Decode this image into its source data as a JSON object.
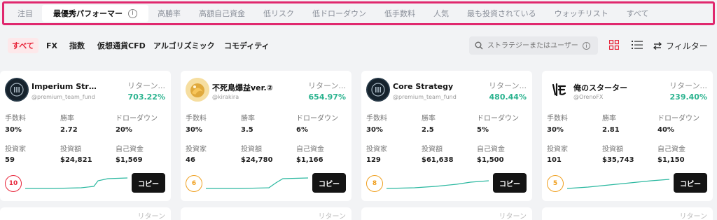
{
  "top_tabs": [
    {
      "label": "注目"
    },
    {
      "label": "最優秀パフォーマー",
      "info": "i"
    },
    {
      "label": "高勝率"
    },
    {
      "label": "高額自己資金"
    },
    {
      "label": "低リスク"
    },
    {
      "label": "低ドローダウン"
    },
    {
      "label": "低手数料"
    },
    {
      "label": "人気"
    },
    {
      "label": "最も投資されている"
    },
    {
      "label": "ウォッチリスト"
    },
    {
      "label": "すべて"
    }
  ],
  "filters": [
    {
      "label": "すべて"
    },
    {
      "label": "FX"
    },
    {
      "label": "指数"
    },
    {
      "label": "仮想通貨CFD"
    },
    {
      "label": "アルゴリズミック"
    },
    {
      "label": "コモディティ"
    }
  ],
  "search": {
    "placeholder": "ストラテジーまたはユーザー...",
    "info": "i"
  },
  "filter_label": "フィルター",
  "colors": {
    "accent": "#e8263b",
    "return": "#2bb38f",
    "tab_border": "#e0286e",
    "sparkline": "#2bb8a0"
  },
  "labels": {
    "return": "リターン...",
    "fee": "手数料",
    "win_rate": "勝率",
    "drawdown": "ドローダウン",
    "investors": "投資家",
    "invested": "投資額",
    "own_funds": "自己資金",
    "copy": "コピー"
  },
  "cards": [
    {
      "name": "Imperium Strate...",
      "handle": "@premium_team_fund",
      "return": "703.22%",
      "fee": "30%",
      "win_rate": "2.72",
      "drawdown": "20%",
      "investors": "59",
      "invested": "$24,821",
      "own_funds": "$1,569",
      "rank": "10",
      "rank_color": "#e8263b",
      "avatar": "imperium-logo-icon"
    },
    {
      "name": "不死鳥爆益ver.②",
      "handle": "@kirakira",
      "return": "654.97%",
      "fee": "30%",
      "win_rate": "3.5",
      "drawdown": "6%",
      "investors": "46",
      "invested": "$24,780",
      "own_funds": "$1,166",
      "rank": "6",
      "rank_color": "#f0a020",
      "avatar": "gold-phoenix-avatar-icon"
    },
    {
      "name": "Core Strategy",
      "handle": "@premium_team_fund",
      "return": "480.44%",
      "fee": "30%",
      "win_rate": "2.5",
      "drawdown": "5%",
      "investors": "129",
      "invested": "$61,638",
      "own_funds": "$1,500",
      "rank": "8",
      "rank_color": "#f0a020",
      "avatar": "imperium-logo-icon"
    },
    {
      "name": "俺のスターター",
      "handle": "@OrenoFX",
      "return": "239.40%",
      "fee": "30%",
      "win_rate": "2.81",
      "drawdown": "40%",
      "investors": "101",
      "invested": "$35,743",
      "own_funds": "$1,150",
      "rank": "5",
      "rank_color": "#f0a020",
      "avatar": "ore-kanji-logo-icon"
    }
  ],
  "second_row_peek": [
    "リターン",
    "リターン",
    "リターン",
    "リターン"
  ]
}
